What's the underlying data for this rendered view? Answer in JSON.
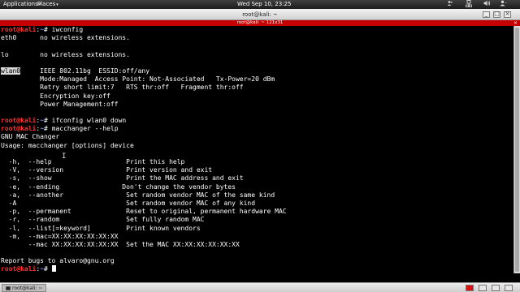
{
  "top_panel": {
    "applications_label": "Applications",
    "places_label": "Places",
    "clock": "Wed Sep 10, 23:25",
    "icons": [
      "people-icon",
      "network-icon",
      "volume-icon",
      "user-menu-icon"
    ]
  },
  "window": {
    "title": "root@kali: ~",
    "tab_title": "root@kali: ~ 121x31",
    "controls": [
      "minimize",
      "maximize",
      "close"
    ]
  },
  "terminal": {
    "prompt": {
      "user": "root@kali",
      "sep": ":",
      "path": "~",
      "symbol": "#"
    },
    "lines": [
      {
        "kind": "prompt",
        "cmd": " iwconfig"
      },
      {
        "kind": "text",
        "text": "eth0      no wireless extensions."
      },
      {
        "kind": "text",
        "text": ""
      },
      {
        "kind": "text",
        "text": "lo        no wireless extensions."
      },
      {
        "kind": "text",
        "text": ""
      },
      {
        "kind": "iface",
        "iface": "wlan0",
        "rest": "     IEEE 802.11bg  ESSID:off/any"
      },
      {
        "kind": "text",
        "text": "          Mode:Managed  Access Point: Not-Associated   Tx-Power=20 dBm"
      },
      {
        "kind": "text",
        "text": "          Retry short limit:7   RTS thr:off   Fragment thr:off"
      },
      {
        "kind": "text",
        "text": "          Encryption key:off"
      },
      {
        "kind": "text",
        "text": "          Power Management:off"
      },
      {
        "kind": "text",
        "text": ""
      },
      {
        "kind": "prompt",
        "cmd": " ifconfig wlan0 down"
      },
      {
        "kind": "prompt",
        "cmd": " macchanger --help"
      },
      {
        "kind": "text",
        "text": "GNU MAC Changer"
      },
      {
        "kind": "text",
        "text": "Usage: macchanger [options] device"
      },
      {
        "kind": "text",
        "text": ""
      },
      {
        "kind": "text",
        "text": "  -h,  --help                   Print this help"
      },
      {
        "kind": "text",
        "text": "  -V,  --version                Print version and exit"
      },
      {
        "kind": "text",
        "text": "  -s,  --show                   Print the MAC address and exit"
      },
      {
        "kind": "text",
        "text": "  -e,  --ending                Don't change the vendor bytes"
      },
      {
        "kind": "text",
        "text": "  -a,  --another                Set random vendor MAC of the same kind"
      },
      {
        "kind": "text",
        "text": "  -A                            Set random vendor MAC of any kind"
      },
      {
        "kind": "text",
        "text": "  -p,  --permanent              Reset to original, permanent hardware MAC"
      },
      {
        "kind": "text",
        "text": "  -r,  --random                 Set fully random MAC"
      },
      {
        "kind": "text",
        "text": "  -l,  --list[=keyword]         Print known vendors"
      },
      {
        "kind": "text",
        "text": "  -m,  --mac=XX:XX:XX:XX:XX:XX"
      },
      {
        "kind": "text",
        "text": "       --mac XX:XX:XX:XX:XX:XX  Set the MAC XX:XX:XX:XX:XX:XX"
      },
      {
        "kind": "text",
        "text": ""
      },
      {
        "kind": "text",
        "text": "Report bugs to alvaro@gnu.org"
      },
      {
        "kind": "prompt",
        "cmd": " ",
        "cursor": true
      }
    ]
  },
  "taskbar": {
    "task_label": "root@kali: ~",
    "workspaces": [
      "active",
      "inactive",
      "inactive",
      "inactive"
    ]
  },
  "colors": {
    "prompt_user": "#ff3333",
    "prompt_path": "#6f8cff",
    "tab_strip": "#c40000",
    "terminal_bg": "#000000"
  }
}
